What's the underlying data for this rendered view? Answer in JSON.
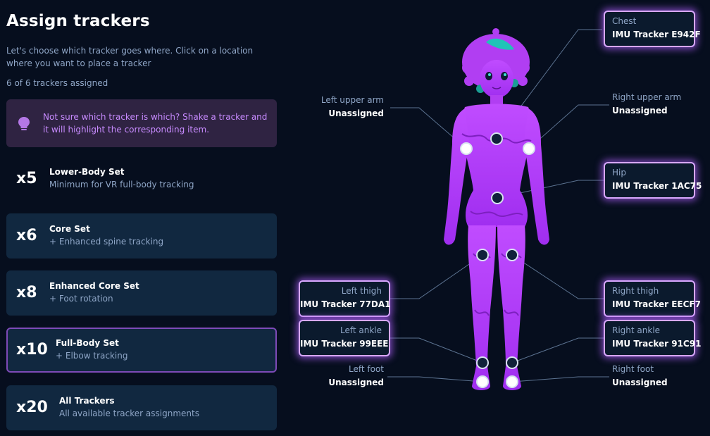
{
  "header": {
    "title": "Assign trackers",
    "description": "Let's choose which tracker goes where. Click on a location where you want to place a tracker",
    "assigned_count": "6 of 6 trackers assigned"
  },
  "hint": {
    "icon": "lightbulb-icon",
    "text": "Not sure which tracker is which? Shake a tracker and it will highlight the corresponding item."
  },
  "sets": [
    {
      "mult": "x5",
      "name": "Lower-Body Set",
      "sub": "Minimum for VR full-body tracking"
    },
    {
      "mult": "x6",
      "name": "Core Set",
      "sub": "+ Enhanced spine tracking"
    },
    {
      "mult": "x8",
      "name": "Enhanced Core Set",
      "sub": "+ Foot rotation"
    },
    {
      "mult": "x10",
      "name": "Full-Body Set",
      "sub": "+ Elbow tracking"
    },
    {
      "mult": "x20",
      "name": "All Trackers",
      "sub": "All available tracker assignments"
    }
  ],
  "body_parts": {
    "chest": {
      "name": "Chest",
      "value": "IMU Tracker E942F"
    },
    "left_upper_arm": {
      "name": "Left upper arm",
      "value": "Unassigned"
    },
    "right_upper_arm": {
      "name": "Right upper arm",
      "value": "Unassigned"
    },
    "hip": {
      "name": "Hip",
      "value": "IMU Tracker 1AC75"
    },
    "left_thigh": {
      "name": "Left thigh",
      "value": "IMU Tracker 77DA1"
    },
    "right_thigh": {
      "name": "Right thigh",
      "value": "IMU Tracker EECF7"
    },
    "left_ankle": {
      "name": "Left ankle",
      "value": "IMU Tracker 99EEE"
    },
    "right_ankle": {
      "name": "Right ankle",
      "value": "IMU Tracker 91C91"
    },
    "left_foot": {
      "name": "Left foot",
      "value": "Unassigned"
    },
    "right_foot": {
      "name": "Right foot",
      "value": "Unassigned"
    }
  },
  "colors": {
    "background": "#060e1e",
    "accent": "#c88bff",
    "body": "#b03ef5",
    "card": "#112840"
  }
}
